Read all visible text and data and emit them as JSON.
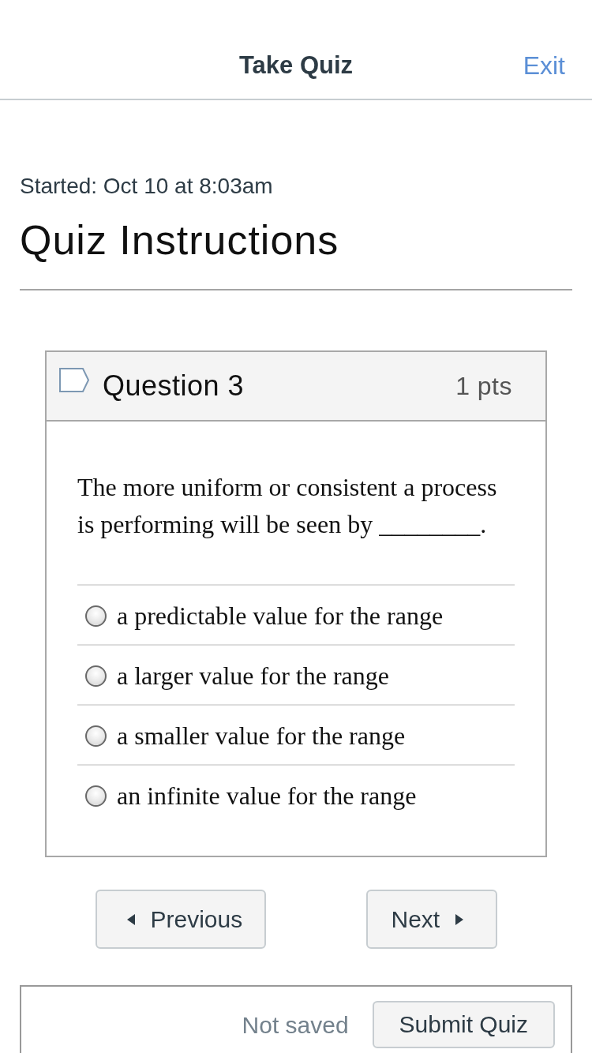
{
  "header": {
    "title": "Take Quiz",
    "exit": "Exit"
  },
  "started": "Started: Oct 10 at 8:03am",
  "heading": "Quiz Instructions",
  "question": {
    "flagged": false,
    "title": "Question 3",
    "points": "1 pts",
    "text": "The more uniform or consistent a process is performing will be seen by ________.",
    "answers": [
      {
        "label": "a predictable value for the range",
        "selected": false
      },
      {
        "label": "a larger value for the range",
        "selected": false
      },
      {
        "label": "a smaller value for the range",
        "selected": false
      },
      {
        "label": "an infinite value for the range",
        "selected": false
      }
    ]
  },
  "navigation": {
    "previous": "Previous",
    "next": "Next"
  },
  "footer": {
    "status": "Not saved",
    "submit": "Submit Quiz"
  }
}
